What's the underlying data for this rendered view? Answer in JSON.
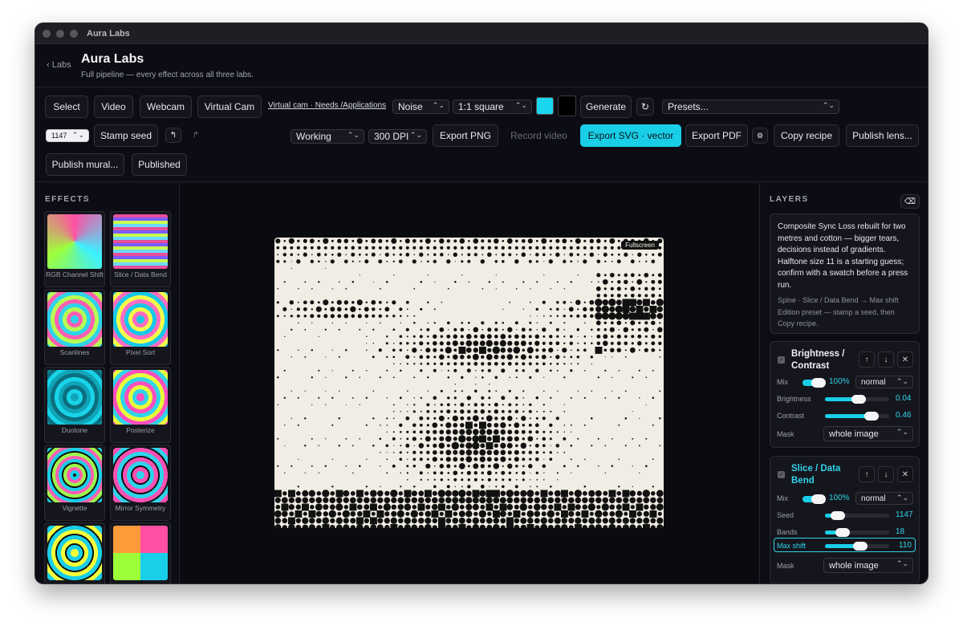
{
  "window": {
    "title": "Aura Labs"
  },
  "header": {
    "back_label": "‹ Labs",
    "title": "Aura Labs",
    "subtitle": "Full pipeline — every effect across all three labs."
  },
  "toolbar": {
    "select": "Select",
    "video": "Video",
    "webcam": "Webcam",
    "virtual_cam": "Virtual Cam",
    "virtual_cam_link": "Virtual cam · Needs /Applications",
    "effect_select": "Noise",
    "aspect_select": "1:1 square",
    "color_a": "#19d6ee",
    "color_b": "#000000",
    "generate": "Generate",
    "presets": "Presets...",
    "seed_value": "1147",
    "stamp_seed": "Stamp seed",
    "undo_glyph": "↰",
    "redo_glyph": "↱",
    "profile_select": "Working",
    "dpi_select": "300 DPI",
    "export_png": "Export PNG",
    "record_video": "Record video",
    "export_svg": "Export SVG · vector",
    "export_pdf": "Export PDF",
    "copy_recipe": "Copy recipe",
    "publish_lens": "Publish lens...",
    "publish_mural": "Publish mural...",
    "published": "Published"
  },
  "effects": {
    "heading": "EFFECTS",
    "items": [
      {
        "label": "RGB Channel Shift"
      },
      {
        "label": "Slice / Data Bend"
      },
      {
        "label": "Scanlines"
      },
      {
        "label": "Pixel Sort"
      },
      {
        "label": "Duotone"
      },
      {
        "label": "Posterize"
      },
      {
        "label": "Vignette"
      },
      {
        "label": "Mirror Symmetry"
      },
      {
        "label": ""
      },
      {
        "label": ""
      }
    ]
  },
  "canvas": {
    "fullscreen_label": "Fullscreen"
  },
  "layers": {
    "heading": "LAYERS",
    "note": {
      "text": "Composite Sync Loss rebuilt for two metres and cotton — bigger tears, decisions instead of gradients. Halftone size 11 is a starting guess; confirm with a swatch before a press run.",
      "spine": "Spine · Slice / Data Bend → Max shift",
      "edition": "Edition preset — stamp a seed, then Copy recipe."
    },
    "cards": [
      {
        "title": "Brightness / Contrast",
        "mix_label": "Mix",
        "mix_value": "100%",
        "blend": "normal",
        "params": [
          {
            "label": "Brightness",
            "value": "0.04",
            "level": 0.52
          },
          {
            "label": "Contrast",
            "value": "0.46",
            "level": 0.73
          }
        ],
        "mask_label": "Mask",
        "mask_value": "whole image"
      },
      {
        "title": "Slice / Data Bend",
        "mix_label": "Mix",
        "mix_value": "100%",
        "blend": "normal",
        "params": [
          {
            "label": "Seed",
            "value": "1147",
            "level": 0.2
          },
          {
            "label": "Bands",
            "value": "18",
            "level": 0.27
          },
          {
            "label": "Max shift",
            "value": "110",
            "level": 0.55
          }
        ],
        "mask_label": "Mask",
        "mask_value": "whole image"
      }
    ]
  }
}
